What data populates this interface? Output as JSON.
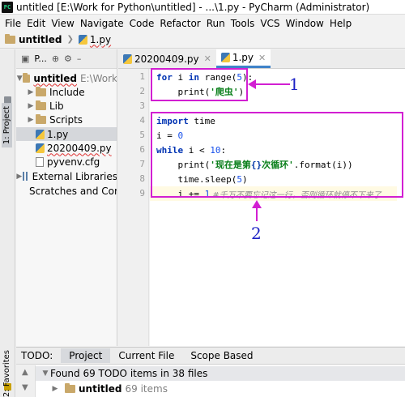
{
  "title_bar": {
    "icon_text": "PC",
    "title": "untitled [E:\\Work for Python\\untitled] - ...\\1.py - PyCharm (Administrator)"
  },
  "menu": [
    "File",
    "Edit",
    "View",
    "Navigate",
    "Code",
    "Refactor",
    "Run",
    "Tools",
    "VCS",
    "Window",
    "Help"
  ],
  "breadcrumb": {
    "project": "untitled",
    "file": "1.py"
  },
  "side_tabs": {
    "project": "1: Project",
    "favorites": "2: Favorites"
  },
  "project_panel": {
    "toolbar_label": "P...",
    "tree": [
      {
        "label": "untitled",
        "extra": "E:\\Work",
        "bold": true
      },
      {
        "label": "Include"
      },
      {
        "label": "Lib"
      },
      {
        "label": "Scripts"
      },
      {
        "label": "1.py",
        "selected": true
      },
      {
        "label": "20200409.py"
      },
      {
        "label": "pyvenv.cfg"
      },
      {
        "label": "External Libraries"
      },
      {
        "label": "Scratches and Cor"
      }
    ]
  },
  "editor_tabs": [
    {
      "label": "20200409.py",
      "active": false
    },
    {
      "label": "1.py",
      "active": true
    }
  ],
  "line_numbers": [
    "1",
    "2",
    "3",
    "4",
    "5",
    "6",
    "7",
    "8",
    "9"
  ],
  "code": {
    "l1": {
      "kw": "for",
      "mid": " i ",
      "kw2": "in",
      "fn": " range(",
      "num": "5",
      "end": "):"
    },
    "l2": {
      "pre": "    print(",
      "str": "'爬虫'",
      "end": ")"
    },
    "l4": {
      "kw": "import",
      "rest": " time"
    },
    "l5": {
      "pre": "i = ",
      "num": "0"
    },
    "l6": {
      "kw": "while",
      "mid": " i < ",
      "num": "10",
      "end": ":"
    },
    "l7": {
      "pre": "    print(",
      "str1": "'现在是第",
      "fmt": "{}",
      "str2": "次循环'",
      "end": ".format(i))"
    },
    "l8": {
      "pre": "    time.sleep(",
      "num": "5",
      "end": ")"
    },
    "l9": {
      "pre": "    i += ",
      "num": "1",
      "cmt": " #千万不要忘记这一行，否则循环就停不下来了"
    }
  },
  "annotations": {
    "one": "1",
    "two": "2"
  },
  "todo": {
    "tabs": [
      "TODO:",
      "Project",
      "Current File",
      "Scope Based"
    ],
    "summary": "Found 69 TODO items in 38 files",
    "project": "untitled",
    "project_items": "69 items"
  }
}
